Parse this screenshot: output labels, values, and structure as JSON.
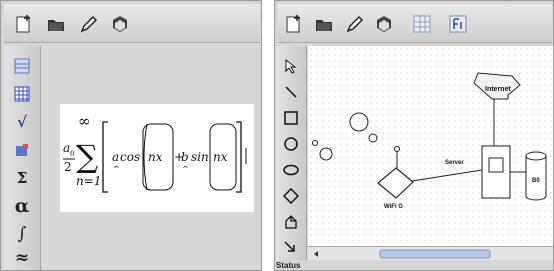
{
  "math_editor": {
    "toolbar": [
      "new-document-icon",
      "open-folder-icon",
      "pencil-icon",
      "box-icon"
    ],
    "sidebar": [
      {
        "icon": "matrix-icon",
        "glyph": ""
      },
      {
        "icon": "table-icon",
        "glyph": ""
      },
      {
        "icon": "square-root-icon",
        "glyph": "√"
      },
      {
        "icon": "insert-icon",
        "glyph": ""
      },
      {
        "icon": "sigma-icon",
        "glyph": "Σ"
      },
      {
        "icon": "alpha-icon",
        "glyph": "α"
      },
      {
        "icon": "integral-icon",
        "glyph": "∫"
      },
      {
        "icon": "approx-icon",
        "glyph": "≈"
      }
    ],
    "formula": {
      "frac_num": "a",
      "frac_sub": "0",
      "frac_den": "2",
      "sum_sym": "∑",
      "sum_upper": "∞",
      "sum_lower": "n=1",
      "a_coef": "a",
      "cos_word": "cos",
      "nx1": "nx",
      "plus": "+",
      "b_coef": "b",
      "sin_word": "sin",
      "nx2": "nx",
      "hat": "^"
    }
  },
  "diagram_editor": {
    "toolbar": [
      "new-document-icon",
      "open-folder-icon",
      "pencil-icon",
      "box-icon",
      "grid-icon",
      "frame-icon"
    ],
    "tools": [
      "pointer-icon",
      "line-icon",
      "rectangle-icon",
      "circle-icon",
      "ellipse-icon",
      "diamond-icon",
      "polygon-icon",
      "connector-icon"
    ],
    "labels": {
      "internet": "Internet",
      "server": "Server",
      "wifi": "WiFi G",
      "db": "B0",
      "status": "Status"
    }
  }
}
